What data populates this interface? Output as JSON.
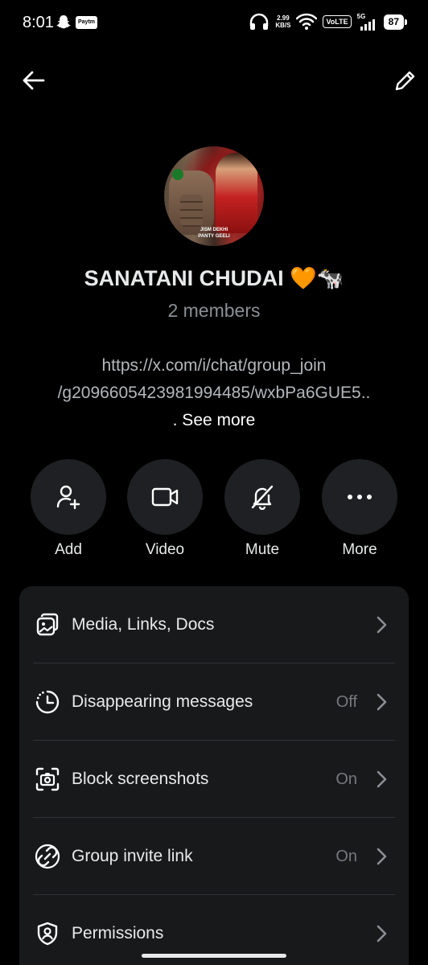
{
  "status_bar": {
    "time": "8:01",
    "paytm": "Paytm",
    "speed_value": "2.99",
    "speed_unit": "KB/S",
    "volte": "VoLTE",
    "network": "5G",
    "battery": "87"
  },
  "header": {
    "back_icon": "arrow-left-icon",
    "edit_icon": "pencil-icon"
  },
  "group": {
    "name": "SANATANI CHUDAI 🧡🐄",
    "members": "2 members",
    "avatar_caption": "JISM DEKHI",
    "avatar_caption_2": "PANTY GEELI",
    "description_line1": "https://x.com/i/chat/group_join",
    "description_line2": "/g2096605423981994485/wxbPa6GUE5..",
    "see_more": ". See more"
  },
  "actions": [
    {
      "label": "Add",
      "icon": "add-user-icon"
    },
    {
      "label": "Video",
      "icon": "video-camera-icon"
    },
    {
      "label": "Mute",
      "icon": "bell-off-icon"
    },
    {
      "label": "More",
      "icon": "more-dots-icon"
    }
  ],
  "settings": [
    {
      "title": "Media, Links, Docs",
      "value": "",
      "icon": "media-icon"
    },
    {
      "title": "Disappearing messages",
      "value": "Off",
      "icon": "timer-icon"
    },
    {
      "title": "Block screenshots",
      "value": "On",
      "icon": "screenshot-icon"
    },
    {
      "title": "Group invite link",
      "value": "On",
      "icon": "link-icon"
    },
    {
      "title": "Permissions",
      "value": "",
      "icon": "shield-user-icon"
    }
  ]
}
